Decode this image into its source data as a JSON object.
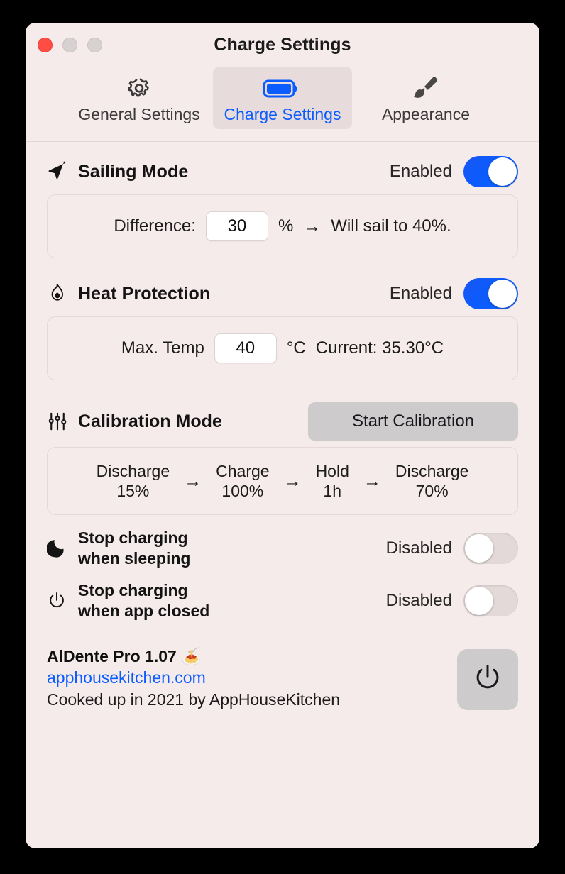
{
  "window": {
    "title": "Charge Settings",
    "traffic_lights": [
      "close",
      "minimize",
      "zoom"
    ]
  },
  "toolbar": {
    "tabs": [
      {
        "label": "General Settings",
        "icon": "gear-icon",
        "active": false
      },
      {
        "label": "Charge Settings",
        "icon": "battery-icon",
        "active": true
      },
      {
        "label": "Appearance",
        "icon": "paintbrush-icon",
        "active": false
      }
    ]
  },
  "sailing": {
    "title": "Sailing Mode",
    "icon": "paper-plane-icon",
    "state_label": "Enabled",
    "toggle_on": true,
    "difference_label": "Difference:",
    "difference_value": "30",
    "percent_unit": "%",
    "arrow": "→",
    "result_text": "Will sail to 40%."
  },
  "heat": {
    "title": "Heat Protection",
    "icon": "flame-icon",
    "state_label": "Enabled",
    "toggle_on": true,
    "max_temp_label": "Max. Temp",
    "max_temp_value": "40",
    "celsius_unit": "°C",
    "current_text": "Current: 35.30°C"
  },
  "calibration": {
    "title": "Calibration Mode",
    "icon": "sliders-icon",
    "start_button": "Start Calibration",
    "arrow": "→",
    "steps": [
      {
        "name": "Discharge",
        "value": "15%"
      },
      {
        "name": "Charge",
        "value": "100%"
      },
      {
        "name": "Hold",
        "value": "1h"
      },
      {
        "name": "Discharge",
        "value": "70%"
      }
    ]
  },
  "switches": [
    {
      "icon": "moon-icon",
      "line1": "Stop charging",
      "line2": "when sleeping",
      "state_label": "Disabled",
      "toggle_on": false
    },
    {
      "icon": "power-icon",
      "line1": "Stop charging",
      "line2": "when app closed",
      "state_label": "Disabled",
      "toggle_on": false
    }
  ],
  "footer": {
    "app_name": "AlDente Pro 1.07 🍝",
    "link": "apphousekitchen.com",
    "credit": "Cooked up in 2021 by AppHouseKitchen",
    "power_button_icon": "power-icon"
  },
  "colors": {
    "window_bg": "#F6EBEB",
    "accent_blue": "#0B5CFF",
    "tab_active_bg": "#E7DBDB",
    "button_grey": "#CDCBCB",
    "toggle_off": "#E4D9D9",
    "close_red": "#FF4D45"
  }
}
